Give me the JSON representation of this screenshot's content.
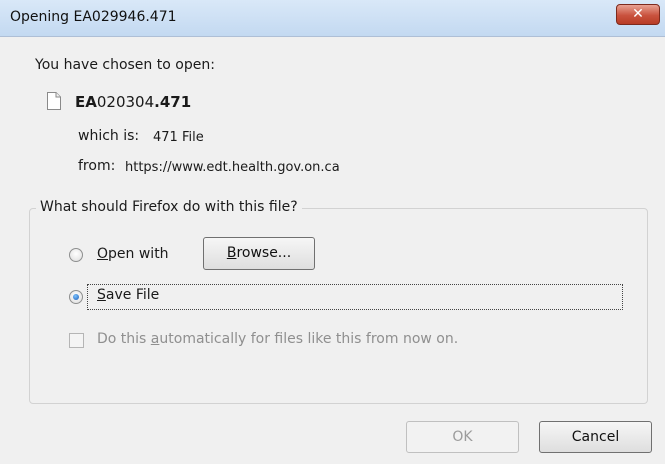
{
  "window": {
    "title": "Opening EA029946.471",
    "close_label": "✕"
  },
  "dialog": {
    "intro": "You have chosen to open:",
    "file_name_prefix": "EA",
    "file_name_middle": "020304",
    "file_name_suffix": ".471",
    "type_label": "which is:",
    "type_value": "471 File",
    "from_label": "from:",
    "from_value": "https://www.edt.health.gov.on.ca"
  },
  "options": {
    "legend": "What should Firefox do with this file?",
    "open_with_label": {
      "before": "",
      "accel": "O",
      "after": "pen with"
    },
    "browse_button": {
      "before": "",
      "accel": "B",
      "after": "rowse..."
    },
    "save_file_label": {
      "before": "",
      "accel": "S",
      "after": "ave File"
    },
    "auto_label": {
      "before": "Do this ",
      "accel": "a",
      "after": "utomatically for files like this from now on."
    },
    "selected": "save_file",
    "auto_checked": false
  },
  "buttons": {
    "ok_label": "OK",
    "cancel_label": "Cancel"
  },
  "colors": {
    "titlebar": "#c3d9f1",
    "close_button": "#c9523e",
    "background": "#f0f0f0",
    "radio_selected": "#1a5bb5"
  }
}
